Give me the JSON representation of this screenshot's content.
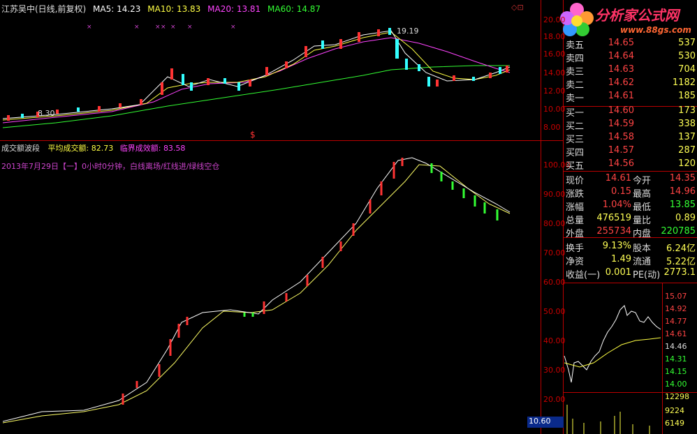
{
  "header": {
    "stock_name": "江苏吴中(日线,前复权)",
    "ma5": "MA5: 14.23",
    "ma10": "MA10: 13.83",
    "ma20": "MA20: 13.81",
    "ma60": "MA60: 14.87",
    "corner_icons": "◇⊡"
  },
  "logo": {
    "title": "分析家公式网",
    "url": "www.88gs.com"
  },
  "top_chart": {
    "y_ticks": [
      "20.00",
      "18.00",
      "16.00",
      "14.00",
      "12.00",
      "10.00",
      "8.00"
    ],
    "low_label": "8.30",
    "high_label": "19.19",
    "dollar_mark": "$"
  },
  "indicator": {
    "name": "成交额波段",
    "avg_label": "平均成交额:",
    "avg_value": "82.73",
    "crit_label": "临界成效额:",
    "crit_value": "83.58",
    "note": "2013年7月29日【一】0小时0分钟，白线离场/红线进/绿线空仓",
    "y_ticks": [
      "100.00",
      "90.00",
      "80.00",
      "70.00",
      "60.00",
      "50.00",
      "40.00",
      "30.00",
      "20.00"
    ],
    "bottom_value": "10.60"
  },
  "quotes": {
    "asks": [
      {
        "label": "卖五",
        "price": "14.65",
        "vol": "537"
      },
      {
        "label": "卖四",
        "price": "14.64",
        "vol": "530"
      },
      {
        "label": "卖三",
        "price": "14.63",
        "vol": "704"
      },
      {
        "label": "卖二",
        "price": "14.62",
        "vol": "1182"
      },
      {
        "label": "卖一",
        "price": "14.61",
        "vol": "185"
      }
    ],
    "bids": [
      {
        "label": "买一",
        "price": "14.60",
        "vol": "173"
      },
      {
        "label": "买二",
        "price": "14.59",
        "vol": "338"
      },
      {
        "label": "买三",
        "price": "14.58",
        "vol": "137"
      },
      {
        "label": "买四",
        "price": "14.57",
        "vol": "287"
      },
      {
        "label": "买五",
        "price": "14.56",
        "vol": "120"
      }
    ]
  },
  "stats": [
    {
      "l1": "现价",
      "v1": "14.61",
      "c1": "#ff4444",
      "l2": "今开",
      "v2": "14.35",
      "c2": "#ff4444"
    },
    {
      "l1": "涨跌",
      "v1": "0.15",
      "c1": "#ff4444",
      "l2": "最高",
      "v2": "14.96",
      "c2": "#ff4444"
    },
    {
      "l1": "涨幅",
      "v1": "1.04%",
      "c1": "#ff4444",
      "l2": "最低",
      "v2": "13.85",
      "c2": "#33ff33"
    },
    {
      "l1": "总量",
      "v1": "476519",
      "c1": "#ffff55",
      "l2": "量比",
      "v2": "0.89",
      "c2": "#ffff55"
    },
    {
      "l1": "外盘",
      "v1": "255734",
      "c1": "#ff4444",
      "l2": "内盘",
      "v2": "220785",
      "c2": "#33ff33"
    },
    {
      "l1": "换手",
      "v1": "9.13%",
      "c1": "#ffff55",
      "l2": "股本",
      "v2": "6.24亿",
      "c2": "#ffff55"
    },
    {
      "l1": "净资",
      "v1": "1.49",
      "c1": "#ffff55",
      "l2": "流通",
      "v2": "5.22亿",
      "c2": "#ffff55"
    },
    {
      "l1": "收益(一)",
      "v1": "0.001",
      "c1": "#ffff55",
      "l2": "PE(动)",
      "v2": "2773.1",
      "c2": "#ffff55"
    }
  ],
  "mini_chart": {
    "prices": [
      "15.07",
      "14.92",
      "14.77",
      "14.61",
      "14.46",
      "14.31",
      "14.15",
      "14.00"
    ],
    "volumes": [
      "12298",
      "9224",
      "6149"
    ]
  },
  "colors": {
    "grid_red": "#aa0000",
    "up": "#ff3333",
    "down": "#33ffff",
    "ma5": "#ffffff",
    "ma10": "#ffff00",
    "ma20": "#ff44ff",
    "ma60": "#33ff33"
  }
}
